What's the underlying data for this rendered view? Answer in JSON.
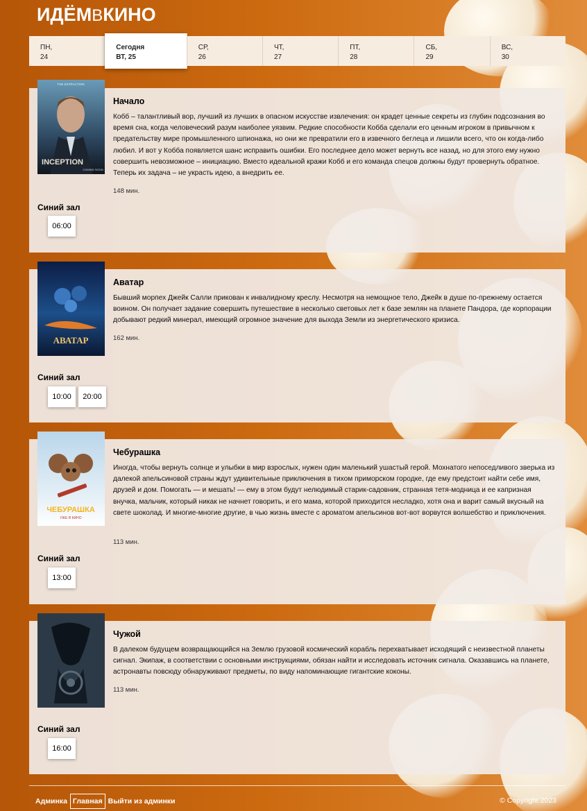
{
  "logo": {
    "part1": "ИДЁМ",
    "part2": "В",
    "part3": "КИНО"
  },
  "days": [
    {
      "name": "ПН,",
      "date": "24",
      "active": false
    },
    {
      "name": "Сегодня",
      "date": "ВТ, 25",
      "active": true
    },
    {
      "name": "СР,",
      "date": "26",
      "active": false
    },
    {
      "name": "ЧТ,",
      "date": "27",
      "active": false
    },
    {
      "name": "ПТ,",
      "date": "28",
      "active": false
    },
    {
      "name": "СБ,",
      "date": "29",
      "active": false
    },
    {
      "name": "ВС,",
      "date": "30",
      "active": false
    }
  ],
  "movies": [
    {
      "title": "Начало",
      "description": "Кобб – талантливый вор, лучший из лучших в опасном искусстве извлечения: он крадет ценные секреты из глубин подсознания во время сна, когда человеческий разум наиболее уязвим. Редкие способности Кобба сделали его ценным игроком в привычном к предательству мире промышленного шпионажа, но они же превратили его в извечного беглеца и лишили всего, что он когда-либо любил. И вот у Кобба появляется шанс исправить ошибки. Его последнее дело может вернуть все назад, но для этого ему нужно совершить невозможное – инициацию. Вместо идеальной кражи Кобб и его команда спецов должны будут провернуть обратное. Теперь их задача – не украсть идею, а внедрить ее.",
      "duration": "148 мин.",
      "hall": "Синий зал",
      "seances": [
        "06:00"
      ],
      "poster_text": [
        "THE EXTRACTION",
        "INCEPTION",
        "COMING SOON"
      ]
    },
    {
      "title": "Аватар",
      "description": "Бывший морпех Джейк Салли прикован к инвалидному креслу. Несмотря на немощное тело, Джейк в душе по-прежнему остается воином. Он получает задание совершить путешествие в несколько световых лет к базе землян на планете Пандора, где корпорации добывают редкий минерал, имеющий огромное значение для выхода Земли из энергетического кризиса.",
      "duration": "162 мин.",
      "hall": "Синий зал",
      "seances": [
        "10:00",
        "20:00"
      ],
      "poster_text": [
        "АВАТАР"
      ]
    },
    {
      "title": "Чебурашка",
      "description": "Иногда, чтобы вернуть солнце и улыбки в мир взрослых, нужен один маленький ушастый герой. Мохнатого непоседливого зверька из далекой апельсиновой страны ждут удивительные приключения в тихом приморском городке, где ему предстоит найти себе имя, друзей и дом. Помогать — и мешать! — ему в этом будут нелюдимый старик-садовник, странная тетя-модница и ее капризная внучка, мальчик, который никак не начнет говорить, и его мама, которой приходится несладко, хотя она и варит самый вкусный на свете шоколад. И многие-многие другие, в чью жизнь вместе с ароматом апельсинов вот-вот ворвутся волшебство и приключения.",
      "duration": "113 мин.",
      "hall": "Синий зал",
      "seances": [
        "13:00"
      ],
      "poster_text": [
        "ЧЕБУРАШКА",
        "УЖЕ В КИНО"
      ]
    },
    {
      "title": "Чужой",
      "description": "В далеком будущем возвращающийся на Землю грузовой космический корабль перехватывает исходящий с неизвестной планеты сигнал. Экипаж, в соответствии с основными инструкциями, обязан найти и исследовать источник сигнала. Оказавшись на планете, астронавты повсюду обнаруживают предметы, по виду напоминающие гигантские коконы.",
      "duration": "113 мин.",
      "hall": "Синий зал",
      "seances": [
        "16:00"
      ],
      "poster_text": []
    }
  ],
  "footer": {
    "nav": [
      "Админка",
      "Главная",
      "Выйти из админки"
    ],
    "active_nav": "Главная",
    "copyright": "© Copyright 2023"
  },
  "colors": {
    "background": "#c8630c",
    "card": "#f1ebe6",
    "day_bar": "#f7ece0"
  }
}
